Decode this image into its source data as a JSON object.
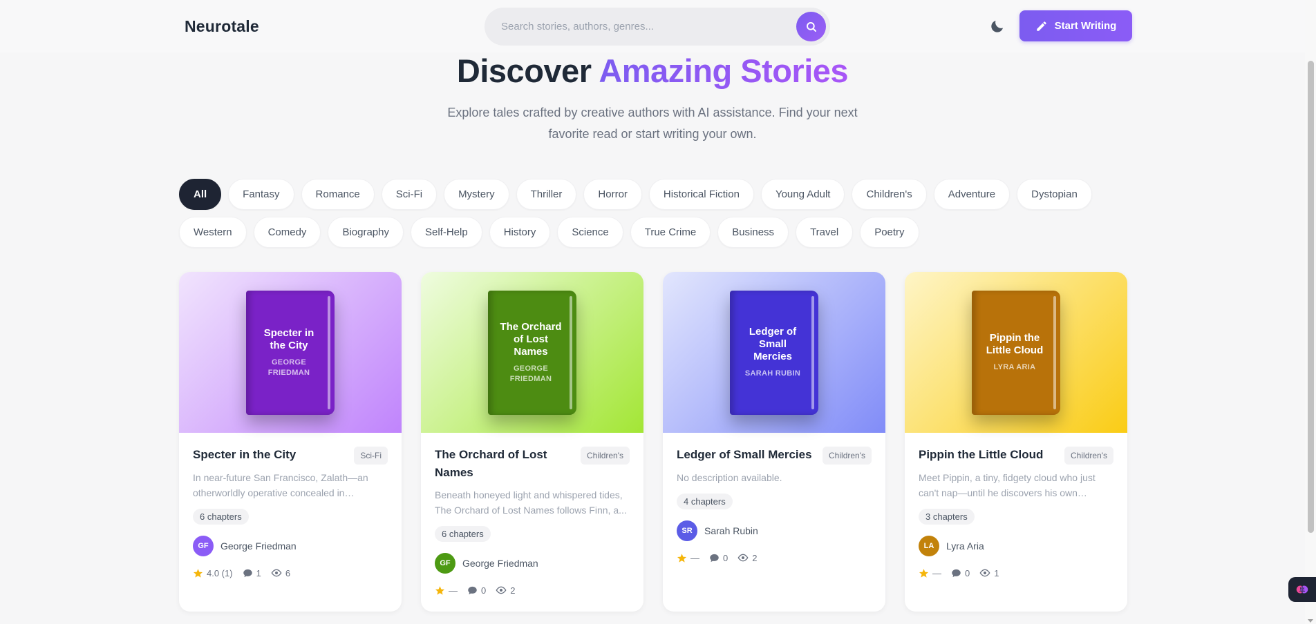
{
  "header": {
    "logo": "Neurotale",
    "search_placeholder": "Search stories, authors, genres...",
    "write_label": "Start Writing"
  },
  "hero": {
    "title_main": "Discover",
    "title_accent": "Amazing Stories",
    "subtitle": "Explore tales crafted by creative authors with AI assistance. Find your next favorite read or start writing your own."
  },
  "genres": [
    "All",
    "Fantasy",
    "Romance",
    "Sci-Fi",
    "Mystery",
    "Thriller",
    "Horror",
    "Historical Fiction",
    "Young Adult",
    "Children's",
    "Adventure",
    "Dystopian",
    "Western",
    "Comedy",
    "Biography",
    "Self-Help",
    "History",
    "Science",
    "True Crime",
    "Business",
    "Travel",
    "Poetry"
  ],
  "active_genre": "All",
  "stories": [
    {
      "title": "Specter in the City",
      "genre": "Sci-Fi",
      "description": "In near-future San Francisco, Zalath—an otherworldly operative concealed in synthetic...",
      "chapters": "6 chapters",
      "author": "George Friedman",
      "initials": "GF",
      "cover_author": "GEORGE FRIEDMAN",
      "rating": "4.0 (1)",
      "comments": "1",
      "views": "6",
      "avatar_color": "#8b5cf6",
      "book_color": "#7a22c7",
      "cover_bg": "linear-gradient(135deg,#f1e4fd,#c084fc)"
    },
    {
      "title": "The Orchard of Lost Names",
      "genre": "Children's",
      "description": "Beneath honeyed light and whispered tides, The Orchard of Lost Names follows Finn, a...",
      "chapters": "6 chapters",
      "author": "George Friedman",
      "initials": "GF",
      "cover_author": "GEORGE FRIEDMAN",
      "rating": "—",
      "comments": "0",
      "views": "2",
      "avatar_color": "#4d9a13",
      "book_color": "#4d8c12",
      "cover_bg": "linear-gradient(135deg,#effce0,#a3e635)"
    },
    {
      "title": "Ledger of Small Mercies",
      "genre": "Children's",
      "description": "No description available.",
      "chapters": "4 chapters",
      "author": "Sarah Rubin",
      "initials": "SR",
      "cover_author": "SARAH RUBIN",
      "rating": "—",
      "comments": "0",
      "views": "2",
      "avatar_color": "#5b5ce6",
      "book_color": "#4433d6",
      "cover_bg": "linear-gradient(135deg,#e2e6fd,#818cf8)"
    },
    {
      "title": "Pippin the Little Cloud",
      "genre": "Children's",
      "description": "Meet Pippin, a tiny, fidgety cloud who just can't nap—until he discovers his own bedtime...",
      "chapters": "3 chapters",
      "author": "Lyra Aria",
      "initials": "LA",
      "cover_author": "LYRA ARIA",
      "rating": "—",
      "comments": "0",
      "views": "1",
      "avatar_color": "#c2820a",
      "book_color": "#b8720a",
      "cover_bg": "linear-gradient(135deg,#fef5c7,#facc15)"
    }
  ]
}
